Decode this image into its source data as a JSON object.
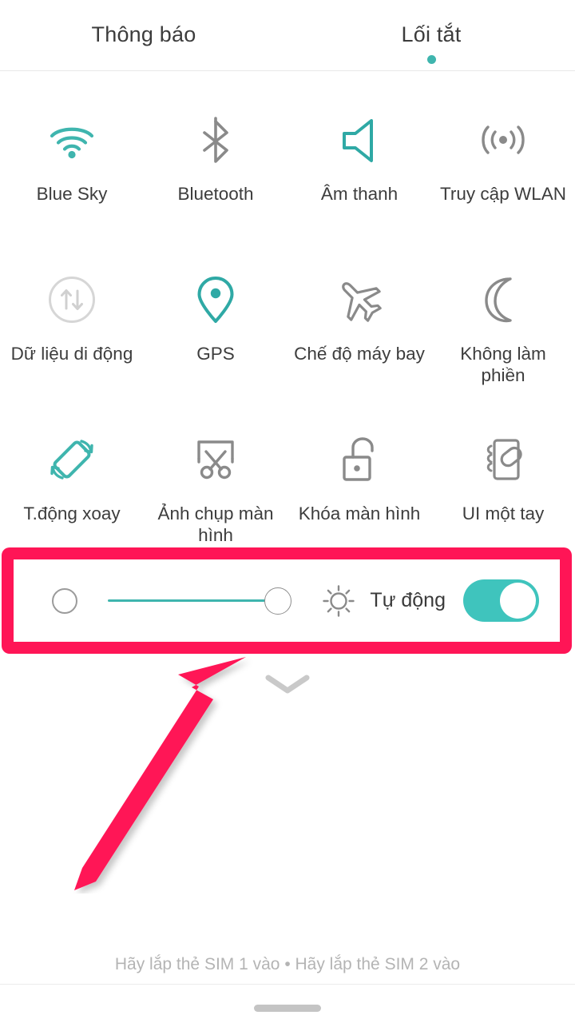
{
  "theme": {
    "accent_teal": "#3fb5ae",
    "toggle_on_teal": "#3fc4bd",
    "inactive_gray": "#8a8a8a",
    "disabled_gray": "#d0d0d0",
    "highlight_pink": "#ff1556",
    "text_dark": "#3c3c3c"
  },
  "header": {
    "tabs": [
      {
        "label": "Thông báo",
        "active": false
      },
      {
        "label": "Lối tắt",
        "active": true
      }
    ]
  },
  "quick_settings": {
    "tiles": [
      {
        "label": "Blue Sky",
        "icon": "wifi-icon",
        "state": "on"
      },
      {
        "label": "Bluetooth",
        "icon": "bluetooth-icon",
        "state": "off"
      },
      {
        "label": "Âm thanh",
        "icon": "sound-icon",
        "state": "on"
      },
      {
        "label": "Truy cập WLAN",
        "icon": "hotspot-icon",
        "state": "off"
      },
      {
        "label": "Dữ liệu di động",
        "icon": "mobile-data-icon",
        "state": "disabled"
      },
      {
        "label": "GPS",
        "icon": "location-pin-icon",
        "state": "on"
      },
      {
        "label": "Chế độ máy bay",
        "icon": "airplane-icon",
        "state": "off"
      },
      {
        "label": "Không làm phiền",
        "icon": "moon-icon",
        "state": "off"
      },
      {
        "label": "T.động xoay",
        "icon": "auto-rotate-icon",
        "state": "on"
      },
      {
        "label": "Ảnh chụp màn hình",
        "icon": "screenshot-icon",
        "state": "off"
      },
      {
        "label": "Khóa màn hình",
        "icon": "unlocked-padlock-icon",
        "state": "off"
      },
      {
        "label": "UI một tay",
        "icon": "one-handed-ui-icon",
        "state": "off"
      }
    ]
  },
  "brightness": {
    "low_icon": "brightness-low-icon",
    "slider_value": 100,
    "sun_icon": "sun-icon",
    "auto_label": "Tự động",
    "auto_enabled": true,
    "highlighted": true
  },
  "expand": {
    "icon": "chevron-down-icon"
  },
  "annotation": {
    "arrow": "pink-arrow-pointing-up-right",
    "color": "#ff1556"
  },
  "footer": {
    "sim_text": "Hãy lắp thẻ SIM 1 vào • Hãy lắp thẻ SIM 2 vào"
  }
}
